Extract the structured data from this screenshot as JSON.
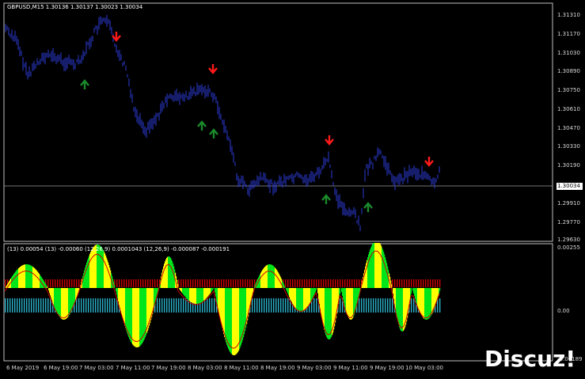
{
  "chart": {
    "title": "GBPUSD,M15  1.30136 1.30137 1.30023 1.30034",
    "current_price": "1.30034",
    "price_ticks": [
      "1.31310",
      "1.31170",
      "1.31030",
      "1.30890",
      "1.30750",
      "1.30610",
      "1.30470",
      "1.30330",
      "1.30190",
      "1.29910",
      "1.29770",
      "1.29630"
    ],
    "time_ticks": [
      "6 May 2019",
      "6 May 19:00",
      "7 May 03:00",
      "7 May 11:00",
      "7 May 19:00",
      "8 May 03:00",
      "8 May 11:00",
      "8 May 19:00",
      "9 May 03:00",
      "9 May 11:00",
      "9 May 19:00",
      "10 May 03:00"
    ]
  },
  "indicator": {
    "header": "(13) 0.00054  (13) -0.00060  (12,26,9) 0.0001043  (12,26,9) -0.000087 -0.000191",
    "scale_top": "0.00255",
    "scale_zero": "0.00",
    "scale_bottom": "-0.00189"
  },
  "signals": {
    "sell_arrows": [
      {
        "time": "7 May 03:00",
        "price": 1.3125
      },
      {
        "time": "8 May 03:00",
        "price": 1.3087
      },
      {
        "time": "9 May 03:00",
        "price": 1.3036
      },
      {
        "time": "10 May 03:00",
        "price": 1.3021
      }
    ],
    "buy_arrows": [
      {
        "time": "6 May 19:00",
        "price": 1.3077
      },
      {
        "time": "8 May 03:00",
        "price": 1.3051
      },
      {
        "time": "8 May 03:00",
        "price": 1.3044
      },
      {
        "time": "9 May 03:00",
        "price": 1.2993
      },
      {
        "time": "9 May 19:00",
        "price": 1.2986
      }
    ]
  },
  "colors": {
    "background": "#000000",
    "candles": "#2b3bd6",
    "sell": "#ff1a1a",
    "buy": "#1b8a2b",
    "histogram_yellow": "#ffff00",
    "histogram_green": "#00e61a",
    "bars_red": "#cc0000",
    "bars_cyan": "#2ab0c8",
    "signal_line": "#cc0000"
  },
  "watermark": "Discuz!"
}
